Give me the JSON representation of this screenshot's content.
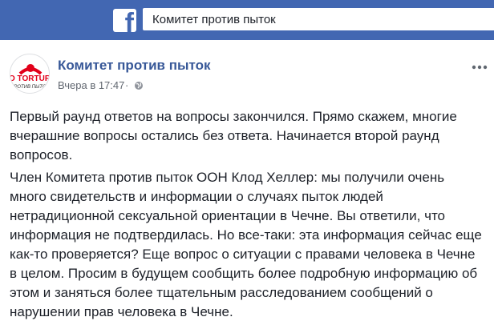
{
  "header": {
    "logo_letter": "f",
    "search_value": "Комитет против пыток",
    "brand_color": "#4267b2"
  },
  "post": {
    "avatar_text_top": "O TORTUR",
    "avatar_text_bottom": "ПРОТИВ ПЫТОК",
    "page_name": "Комитет против пыток",
    "timestamp": "Вчера в 17:47",
    "separator": "·",
    "paragraphs": [
      "Первый раунд ответов на вопросы закончился. Прямо скажем, многие вчерашние вопросы остались без ответа. Начинается второй раунд вопросов.",
      "Член Комитета против пыток ООН Клод Хеллер: мы получили очень много свидетельств и информации о случаях пыток людей нетрадиционной сексуальной ориентации в Чечне. Вы ответили, что информация не подтвердилась. Но все-таки: эта информация сейчас еще как-то проверяется? Еще вопрос о ситуации с правами человека в Чечне в целом. Просим в будущем сообщить более подробную информацию об этом и заняться более тщательным расследованием сообщений о нарушении прав человека в Чечне."
    ]
  },
  "icons": {
    "logo": "facebook-logo-icon",
    "privacy": "globe-icon",
    "options": "more-options-icon"
  }
}
